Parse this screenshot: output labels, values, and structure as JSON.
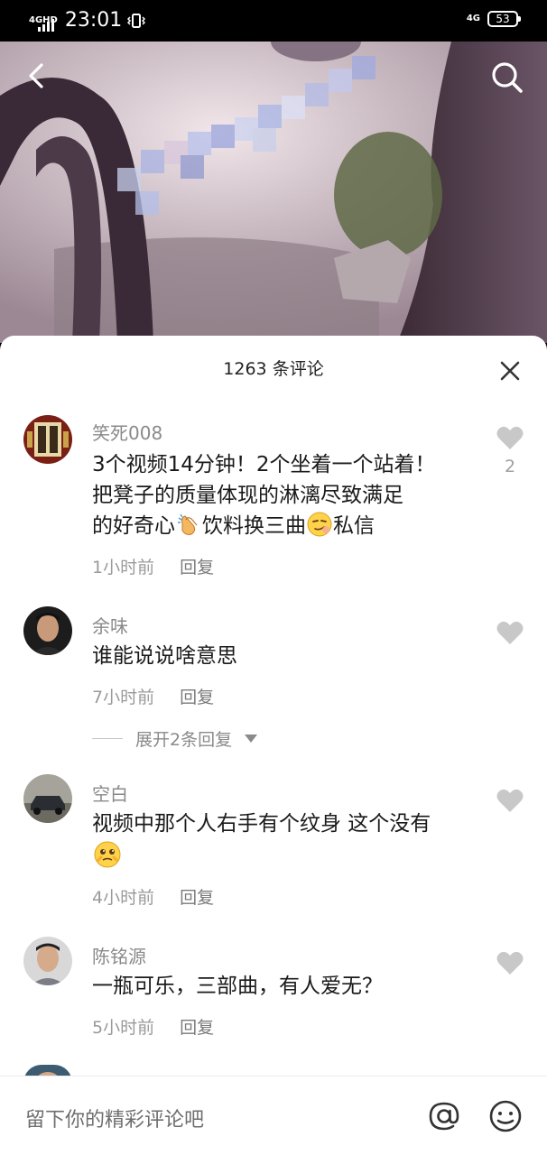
{
  "status_bar": {
    "network_label": "4GHD",
    "time": "23:01",
    "network_right": "4G",
    "battery": "53"
  },
  "video": {
    "back_icon": "back-arrow-icon",
    "search_icon": "search-icon"
  },
  "comments_sheet": {
    "count_label": "1263 条评论",
    "close_icon": "close-icon",
    "comments": [
      {
        "username": "笑死008",
        "text_line1": "3个视频14分钟！2个坐着一个站着！",
        "text_line2": "把凳子的质量体现的淋漓尽致满足",
        "text_line3_a": "的好奇心",
        "text_line3_b": "饮料换三曲",
        "text_line3_c": "私信",
        "time": "1小时前",
        "reply": "回复",
        "likes": "2"
      },
      {
        "username": "余味",
        "text": "谁能说说啥意思",
        "time": "7小时前",
        "reply": "回复",
        "expand": "展开2条回复"
      },
      {
        "username": "空白",
        "text": "视频中那个人右手有个纹身 这个没有",
        "time": "4小时前",
        "reply": "回复"
      },
      {
        "username": "陈铭源",
        "text": "一瓶可乐，三部曲，有人爱无？",
        "time": "5小时前",
        "reply": "回复"
      }
    ]
  },
  "input_bar": {
    "placeholder": "留下你的精彩评论吧",
    "at_icon": "at-icon",
    "emoji_icon": "emoji-icon"
  }
}
